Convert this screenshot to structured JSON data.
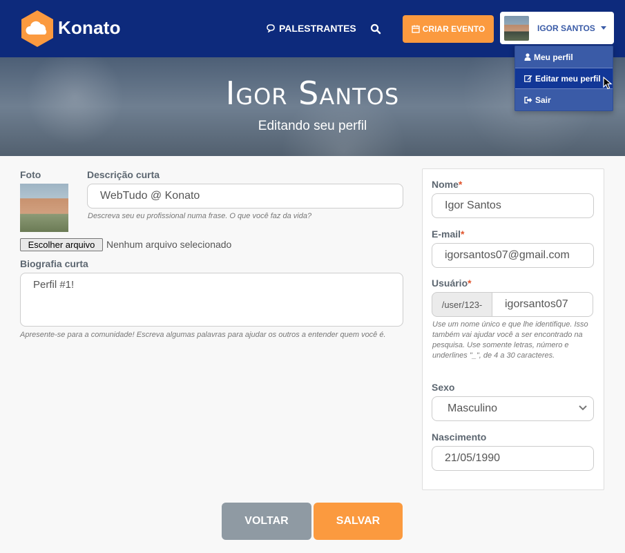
{
  "navbar": {
    "brand": "Konato",
    "speakers_label": "PALESTRANTES",
    "create_event_label": "CRIAR EVENTO",
    "user_name": "IGOR SANTOS"
  },
  "dropdown": {
    "items": [
      {
        "label": "Meu perfil",
        "icon": "user-icon"
      },
      {
        "label": "Editar meu perfil",
        "icon": "edit-icon"
      },
      {
        "label": "Sair",
        "icon": "sign-out-icon"
      }
    ],
    "active_index": 1
  },
  "hero": {
    "title": "Igor Santos",
    "subtitle": "Editando seu perfil"
  },
  "profile_form": {
    "photo_label": "Foto",
    "short_description_label": "Descrição curta",
    "short_description_value": "WebTudo @ Konato",
    "short_description_help": "Descreva seu eu profissional numa frase. O que você faz da vida?",
    "file_button_label": "Escolher arquivo",
    "file_status": "Nenhum arquivo selecionado",
    "bio_label": "Biografia curta",
    "bio_value": "Perfil #1!",
    "bio_help": "Apresente-se para a comunidade! Escreva algumas palavras para ajudar os outros a entender quem você é."
  },
  "account_form": {
    "name_label": "Nome",
    "name_value": "Igor Santos",
    "email_label": "E-mail",
    "email_value": "igorsantos07@gmail.com",
    "username_label": "Usuário",
    "username_prefix": "/user/123-",
    "username_value": "igorsantos07",
    "username_help": "Use um nome único e que lhe identifique. Isso também vai ajudar você a ser encontrado na pesquisa. Use somente letras, número e underlines \"_\", de 4 a 30 caracteres.",
    "gender_label": "Sexo",
    "gender_value": "Masculino",
    "birth_label": "Nascimento",
    "birth_value": "21/05/1990",
    "required_mark": "*"
  },
  "actions": {
    "back_label": "VOLTAR",
    "save_label": "SALVAR"
  },
  "colors": {
    "navbar": "#0d2a7c",
    "accent_orange": "#fb9a3f",
    "dropdown": "#3a5ba7",
    "back_button": "#8f9aa3"
  }
}
